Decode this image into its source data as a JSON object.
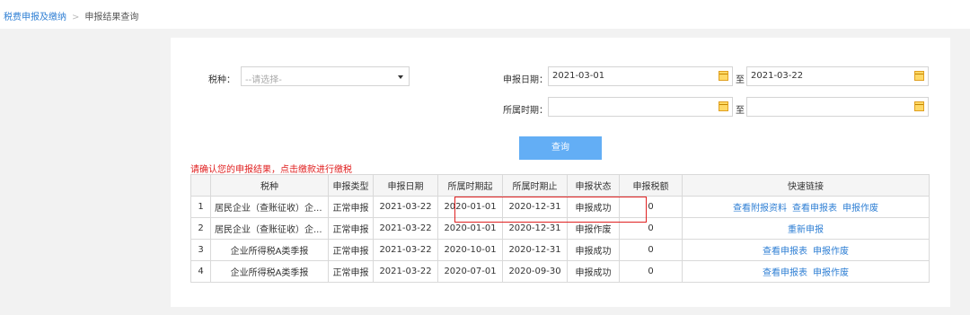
{
  "breadcrumb": {
    "parent": "税费申报及缴纳",
    "sep": ">",
    "current": "申报结果查询"
  },
  "form": {
    "tax_type_label": "税种：",
    "tax_type_placeholder": "--请选择-",
    "decl_date_label": "申报日期：",
    "decl_date_from": "2021-03-01",
    "to_label": "至",
    "decl_date_to": "2021-03-22",
    "period_label": "所属时期：",
    "period_from": "",
    "period_to": "",
    "query_label": "查询"
  },
  "notice": "请确认您的申报结果，点击缴款进行缴税",
  "table": {
    "headers": [
      "",
      "税种",
      "申报类型",
      "申报日期",
      "所属时期起",
      "所属时期止",
      "申报状态",
      "申报税额",
      "快速链接"
    ],
    "rows": [
      {
        "no": "1",
        "tax": "居民企业（查账征收）企...",
        "type": "正常申报",
        "date": "2021-03-22",
        "from": "2020-01-01",
        "to": "2020-12-31",
        "status": "申报成功",
        "amount": "0",
        "links": [
          "查看附报资料",
          "查看申报表",
          "申报作废"
        ]
      },
      {
        "no": "2",
        "tax": "居民企业（查账征收）企...",
        "type": "正常申报",
        "date": "2021-03-22",
        "from": "2020-01-01",
        "to": "2020-12-31",
        "status": "申报作废",
        "amount": "0",
        "links": [
          "重新申报"
        ]
      },
      {
        "no": "3",
        "tax": "企业所得税A类季报",
        "type": "正常申报",
        "date": "2021-03-22",
        "from": "2020-10-01",
        "to": "2020-12-31",
        "status": "申报成功",
        "amount": "0",
        "links": [
          "查看申报表",
          "申报作废"
        ]
      },
      {
        "no": "4",
        "tax": "企业所得税A类季报",
        "type": "正常申报",
        "date": "2021-03-22",
        "from": "2020-07-01",
        "to": "2020-09-30",
        "status": "申报成功",
        "amount": "0",
        "links": [
          "查看申报表",
          "申报作废"
        ]
      }
    ]
  },
  "icons": {
    "calendar": "calendar-icon",
    "caret": "chevron-down-icon"
  },
  "colors": {
    "accent": "#2f7fd4",
    "button": "#63aef5",
    "alert": "#e02020"
  }
}
